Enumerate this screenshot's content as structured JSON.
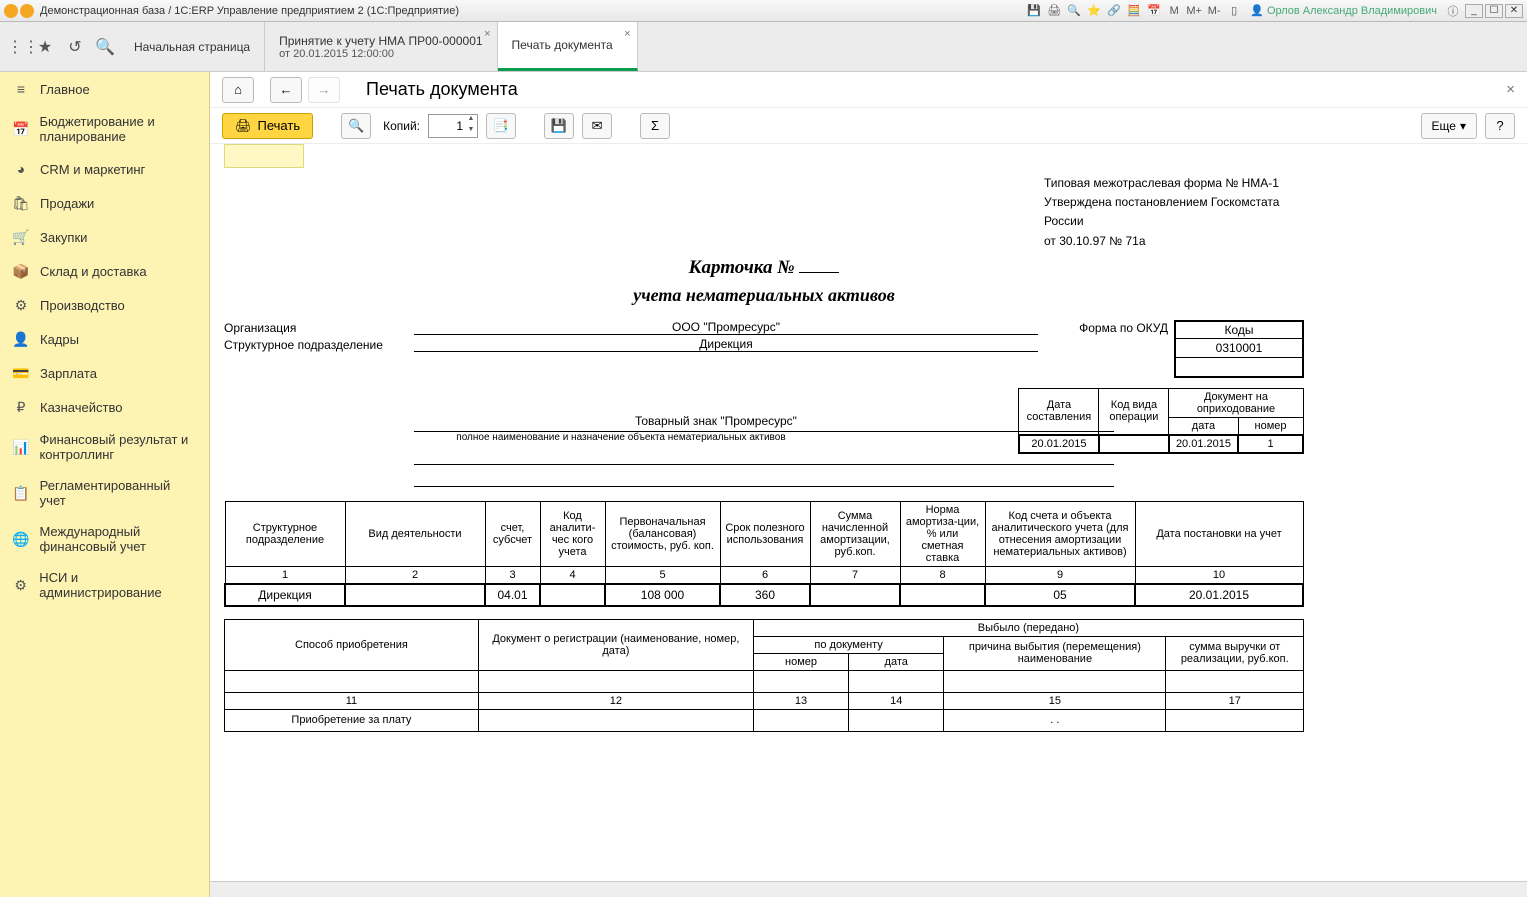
{
  "titlebar": {
    "title": "Демонстрационная база / 1С:ERP Управление предприятием 2  (1С:Предприятие)",
    "user": "Орлов Александр Владимирович",
    "m": "М",
    "mplus": "М+",
    "mminus": "М-"
  },
  "tabs": {
    "home": "Начальная страница",
    "doc": "Принятие к учету НМА ПР00-000001",
    "doc_sub": "от 20.01.2015 12:00:00",
    "print": "Печать документа"
  },
  "sidebar": {
    "items": [
      {
        "icon": "≡",
        "label": "Главное"
      },
      {
        "icon": "📅",
        "label": "Бюджетирование и планирование"
      },
      {
        "icon": "◕",
        "label": "CRM и маркетинг"
      },
      {
        "icon": "🛍",
        "label": "Продажи"
      },
      {
        "icon": "🛒",
        "label": "Закупки"
      },
      {
        "icon": "📦",
        "label": "Склад и доставка"
      },
      {
        "icon": "⚙",
        "label": "Производство"
      },
      {
        "icon": "👤",
        "label": "Кадры"
      },
      {
        "icon": "💳",
        "label": "Зарплата"
      },
      {
        "icon": "₽",
        "label": "Казначейство"
      },
      {
        "icon": "📊",
        "label": "Финансовый результат и контроллинг"
      },
      {
        "icon": "📋",
        "label": "Регламентированный учет"
      },
      {
        "icon": "🌐",
        "label": "Международный финансовый учет"
      },
      {
        "icon": "⚙",
        "label": "НСИ и администрирование"
      }
    ]
  },
  "header": {
    "title": "Печать документа"
  },
  "toolbar": {
    "print": "Печать",
    "copies_label": "Копий:",
    "copies_value": "1",
    "more": "Еще",
    "help": "?"
  },
  "doc": {
    "form_line1": "Типовая межотраслевая форма № НМА-1",
    "form_line2": "Утверждена постановлением Госкомстата России",
    "form_line3": "от 30.10.97 № 71а",
    "card_title_prefix": "Карточка  № ",
    "card_sub": "учета нематериальных активов",
    "codes_hdr": "Коды",
    "okud_code": "0310001",
    "okud_label": "Форма по ОКУД",
    "org_label": "Организация",
    "org_value": "ООО \"Промресурс\"",
    "dept_label": "Структурное подразделение",
    "dept_value": "Дирекция",
    "mini": {
      "date_hdr": "Дата составления",
      "op_hdr": "Код вида операции",
      "docin_hdr": "Документ на оприходование",
      "date_sub": "дата",
      "num_sub": "номер",
      "date_val": "20.01.2015",
      "docdate_val": "20.01.2015",
      "docnum_val": "1"
    },
    "desc_value": "Товарный знак \"Промресурс\"",
    "desc_sub": "полное наименование и назначение объекта нематериальных активов",
    "main_headers": {
      "c1": "Структурное подразделение",
      "c2": "Вид деятельности",
      "c3": "счет, субсчет",
      "c4": "Код аналити-чес кого учета",
      "c5": "Первоначальная (балансовая) стоимость, руб. коп.",
      "c6": "Срок полезного использования",
      "c7": "Сумма начисленной амортизации, руб.коп.",
      "c8": "Норма амортиза-ции, % или сметная ставка",
      "c9": "Код счета и объекта аналитического учета (для отнесения амортизации нематериальных активов)",
      "c10": "Дата постановки на учет"
    },
    "main_nums": {
      "n1": "1",
      "n2": "2",
      "n3": "3",
      "n4": "4",
      "n5": "5",
      "n6": "6",
      "n7": "7",
      "n8": "8",
      "n9": "9",
      "n10": "10"
    },
    "main_data": {
      "dept": "Дирекция",
      "acct": "04.01",
      "cost": "108 000",
      "term": "360",
      "amort_code": "05",
      "reg_date": "20.01.2015"
    },
    "t2_headers": {
      "acq": "Способ приобретения",
      "regdoc": "Документ о регистрации (наименование, номер, дата)",
      "disposed": "Выбыло (передано)",
      "bydoc": "по документу",
      "reason": "причина выбытия (перемещения) наименование",
      "revenue": "сумма выручки от реализации, руб.коп.",
      "num": "номер",
      "date": "дата"
    },
    "t2_nums": {
      "n11": "11",
      "n12": "12",
      "n13": "13",
      "n14": "14",
      "n15": "15",
      "n17": "17"
    },
    "t2_data": {
      "acq": "Приобретение за плату",
      "reason": ". ."
    }
  }
}
